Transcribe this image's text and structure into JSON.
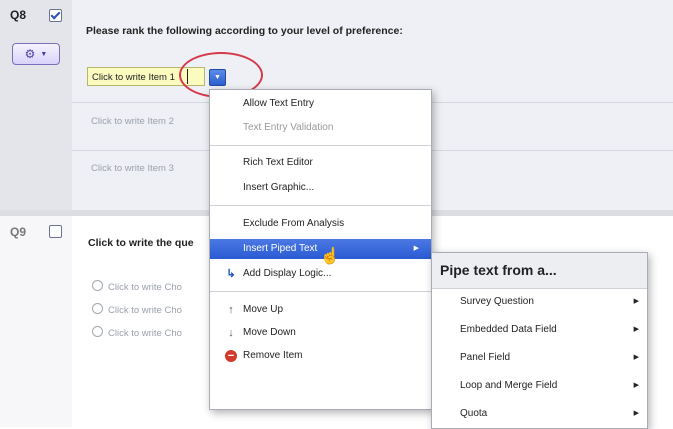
{
  "q8": {
    "number": "Q8",
    "question_text": "Please rank the following according to your level of preference:",
    "items": [
      {
        "text": "Click to write Item 1"
      },
      {
        "placeholder": "Click to write Item 2"
      },
      {
        "placeholder": "Click to write Item 3"
      }
    ],
    "gear_icon": "gear-icon",
    "dropdown_arrow": "▼"
  },
  "q9": {
    "number": "Q9",
    "question_text": "Click to write the que",
    "choices": [
      "Click to write Cho",
      "Click to write Cho",
      "Click to write Cho"
    ]
  },
  "item_menu": {
    "allow_text_entry": "Allow Text Entry",
    "text_entry_validation": "Text Entry Validation",
    "rich_text_editor": "Rich Text Editor",
    "insert_graphic": "Insert Graphic...",
    "exclude_from_analysis": "Exclude From Analysis",
    "insert_piped_text": "Insert Piped Text",
    "add_display_logic": "Add Display Logic...",
    "move_up": "Move Up",
    "move_down": "Move Down",
    "remove_item": "Remove Item"
  },
  "piped_submenu": {
    "title": "Pipe text from a...",
    "items": [
      "Survey Question",
      "Embedded Data Field",
      "Panel Field",
      "Loop and Merge Field",
      "Quota"
    ]
  },
  "colors": {
    "highlight": "#2a5bd3",
    "annotation_circle": "#d5394a",
    "editing_field": "#fbfbc0"
  }
}
